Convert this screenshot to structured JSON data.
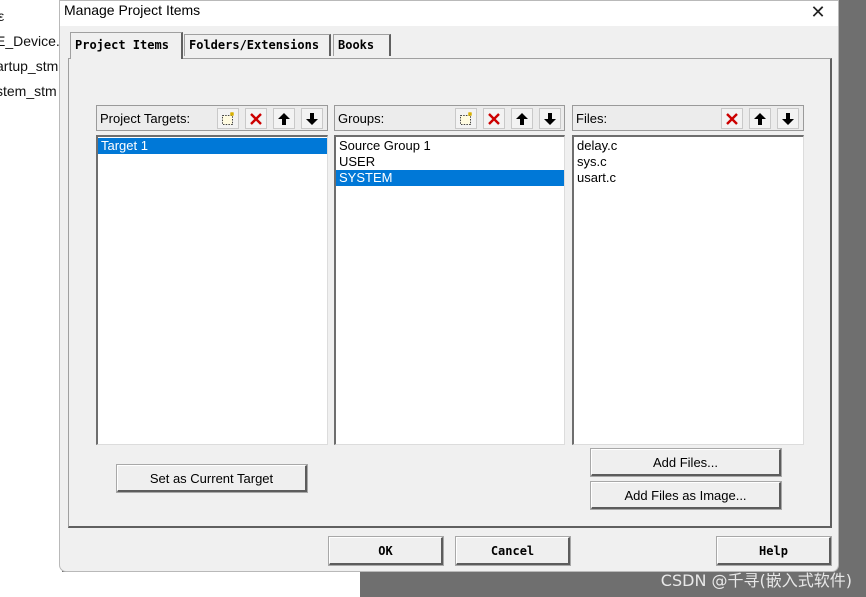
{
  "background": {
    "lines": [
      "E_Device.",
      "artup_stm",
      "stem_stm"
    ],
    "watermark": "CSDN @千寻(嵌入式软件)"
  },
  "dialog": {
    "title": "Manage Project Items",
    "close_symbol": "✕",
    "tabs": [
      "Project Items",
      "Folders/Extensions",
      "Books"
    ],
    "active_tab": "Project Items"
  },
  "targets": {
    "label": "Project Targets:",
    "items": [
      "Target 1"
    ],
    "selected": "Target 1",
    "tools": [
      "new-icon",
      "delete-icon",
      "move-up-icon",
      "move-down-icon"
    ]
  },
  "groups": {
    "label": "Groups:",
    "items": [
      "Source Group 1",
      "USER",
      "SYSTEM"
    ],
    "selected": "SYSTEM",
    "tools": [
      "new-icon",
      "delete-icon",
      "move-up-icon",
      "move-down-icon"
    ]
  },
  "files": {
    "label": "Files:",
    "items": [
      "delay.c",
      "sys.c",
      "usart.c"
    ],
    "tools": [
      "delete-icon",
      "move-up-icon",
      "move-down-icon"
    ]
  },
  "buttons": {
    "set_current_target": "Set as Current Target",
    "add_files": "Add Files...",
    "add_files_image": "Add Files as Image...",
    "ok": "OK",
    "cancel": "Cancel",
    "help": "Help"
  },
  "colors": {
    "selection": "#0078d7",
    "delete_icon": "#cc0000"
  }
}
